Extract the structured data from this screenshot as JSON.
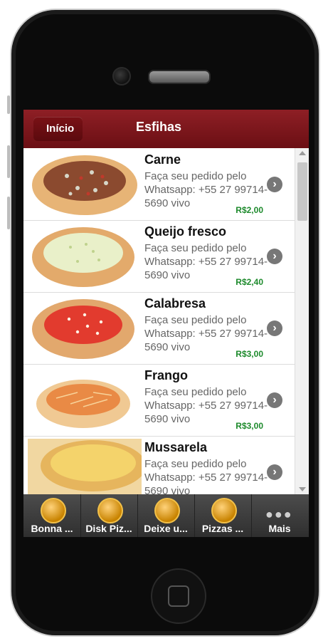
{
  "header": {
    "back_label": "Início",
    "title": "Esfihas"
  },
  "items": [
    {
      "name": "Carne",
      "desc": "Faça seu pedido pelo Whatsapp: +55 27 99714-5690 vivo",
      "price": "R$2,00"
    },
    {
      "name": "Queijo fresco",
      "desc": "Faça seu pedido pelo Whatsapp: +55 27 99714-5690 vivo",
      "price": "R$2,40"
    },
    {
      "name": "Calabresa",
      "desc": "Faça seu pedido pelo Whatsapp: +55 27 99714-5690 vivo",
      "price": "R$3,00"
    },
    {
      "name": "Frango",
      "desc": "Faça seu pedido pelo Whatsapp: +55 27 99714-5690 vivo",
      "price": "R$3,00"
    },
    {
      "name": "Mussarela",
      "desc": "Faça seu pedido pelo Whatsapp: +55 27 99714-5690 vivo",
      "price": ""
    }
  ],
  "tabs": [
    {
      "label": "Bonna ...",
      "icon": "pizza-logo-icon"
    },
    {
      "label": "Disk Piz...",
      "icon": "chef-icon"
    },
    {
      "label": "Deixe u...",
      "icon": "chat-bubble-icon"
    },
    {
      "label": "Pizzas ...",
      "icon": "pizza-slice-icon"
    },
    {
      "label": "Mais",
      "icon": "more-dots-icon"
    }
  ],
  "colors": {
    "header": "#8e1f25",
    "price": "#1d8a2c"
  }
}
